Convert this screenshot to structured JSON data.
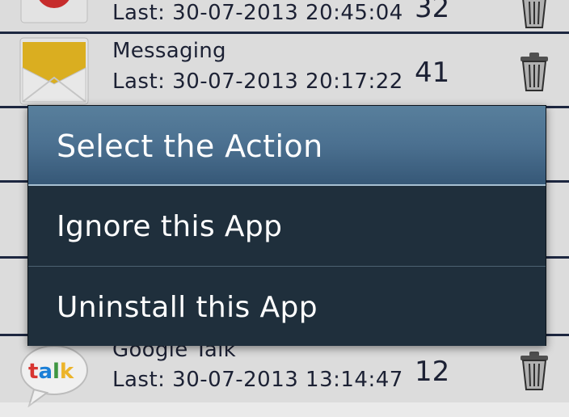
{
  "apps": [
    {
      "name": "",
      "last": "Last: 30-07-2013  20:45:04",
      "count": "32",
      "icon": "gmail-envelope-icon"
    },
    {
      "name": "Messaging",
      "last": "Last: 30-07-2013  20:17:22",
      "count": "41",
      "icon": "messaging-envelope-icon"
    },
    {
      "name": "Google Talk",
      "last": "Last: 30-07-2013  13:14:47",
      "count": "12",
      "icon": "talk-bubble-icon",
      "icon_text": "talk"
    }
  ],
  "dialog": {
    "title": "Select the Action",
    "items": [
      {
        "label": "Ignore this App"
      },
      {
        "label": "Uninstall this App"
      }
    ]
  },
  "colors": {
    "list_background": "#eaeaea",
    "row_divider": "#1f2a44",
    "text": "#1e2438",
    "dialog_title_bg": "#4b7090",
    "dialog_body_bg": "#1f2f3c",
    "talk_t": "#e53935",
    "talk_a": "#1e88e5",
    "talk_l": "#43a047",
    "talk_k": "#fbc02d"
  }
}
